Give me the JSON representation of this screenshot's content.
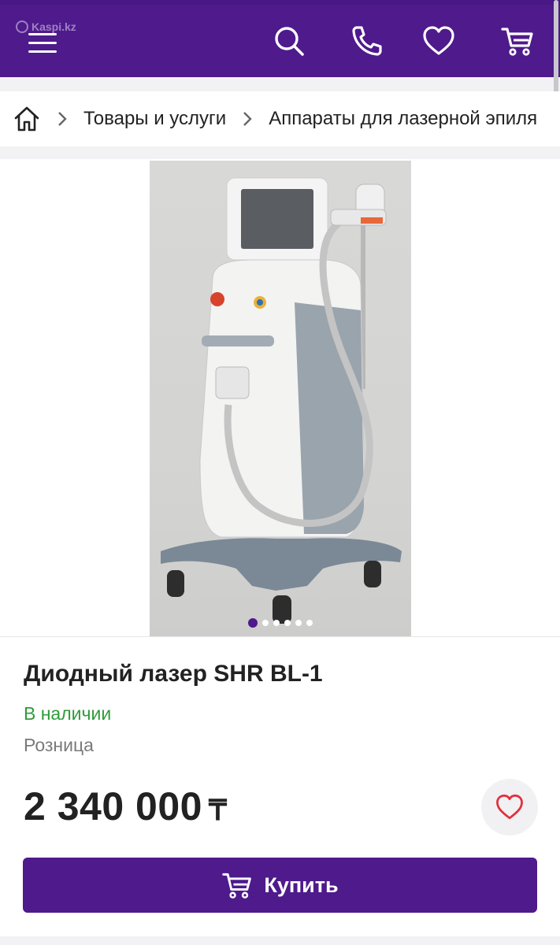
{
  "brand": {
    "watermark": "Kaspi.kz",
    "accent": "#4f1a8c"
  },
  "header": {
    "icons": [
      "menu-icon",
      "search-icon",
      "phone-icon",
      "heart-icon",
      "cart-icon"
    ]
  },
  "breadcrumb": {
    "items": [
      "Товары и услуги",
      "Аппараты для лазерной эпиля"
    ]
  },
  "gallery": {
    "image_count": 6,
    "active_index": 0
  },
  "product": {
    "title": "Диодный лазер SHR BL-1",
    "availability": "В наличии",
    "category": "Розница",
    "price": "2 340 000",
    "currency": "₸",
    "status_color": "#2e9b3a"
  },
  "actions": {
    "buy_label": "Купить"
  }
}
